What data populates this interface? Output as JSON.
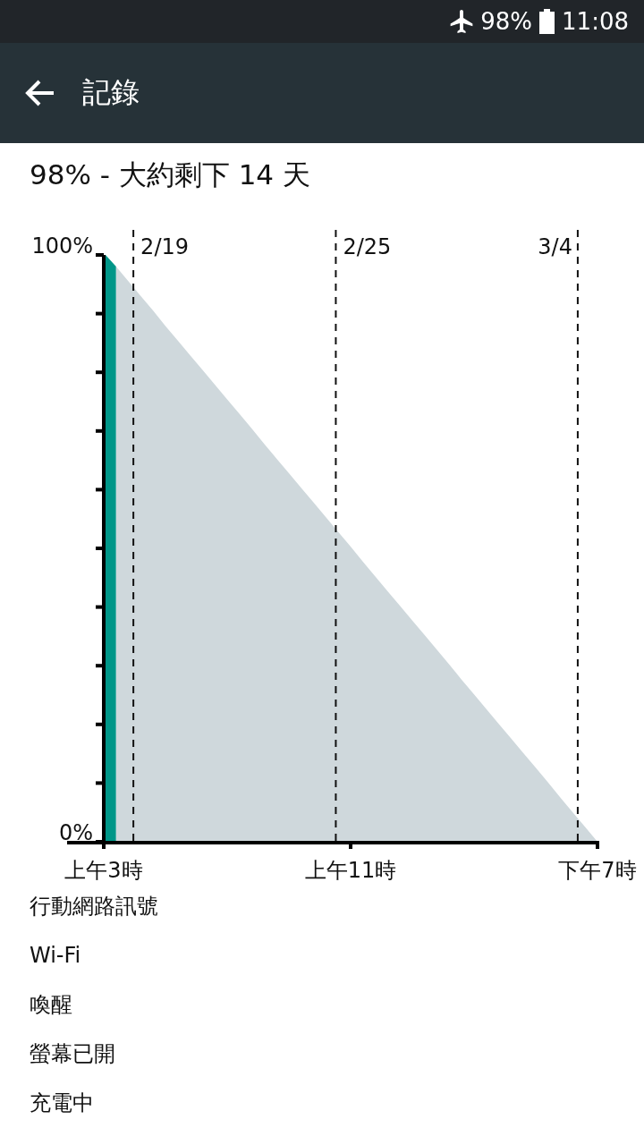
{
  "status_bar": {
    "battery": "98%",
    "time": "11:08"
  },
  "app_bar": {
    "title": "記錄"
  },
  "summary": "98% - 大約剩下 14 天",
  "chart": {
    "chart_data": {
      "type": "area",
      "categories": [
        "上午3時",
        null,
        null,
        null,
        null,
        null,
        null,
        null,
        null,
        null,
        null,
        null,
        null,
        null,
        null,
        null,
        null,
        null,
        null,
        null,
        "上午11時",
        null,
        null,
        null,
        null,
        null,
        null,
        null,
        null,
        null,
        null,
        null,
        null,
        null,
        null,
        null,
        null,
        null,
        null,
        null,
        "下午7時"
      ],
      "series": [
        {
          "color": "#009688",
          "values": [
            100,
            98,
            null,
            null,
            null,
            null,
            null,
            null,
            null,
            null,
            null,
            null,
            null,
            null,
            null,
            null,
            null,
            null,
            null,
            null,
            null,
            null,
            null,
            null,
            null,
            null,
            null,
            null,
            null,
            null,
            null,
            null,
            null,
            null,
            null,
            null,
            null,
            null,
            null,
            null,
            null
          ]
        },
        {
          "color": "#cfd8dc",
          "values": [
            null,
            98,
            95.5,
            93,
            90.5,
            87.9,
            85.4,
            82.9,
            80.4,
            77.9,
            75.4,
            72.9,
            70.4,
            67.8,
            65.3,
            62.8,
            60.3,
            57.8,
            55.3,
            52.8,
            50.3,
            47.7,
            45.2,
            42.7,
            40.2,
            37.7,
            35.2,
            32.7,
            30.2,
            27.6,
            25.1,
            22.6,
            20.1,
            17.6,
            15.1,
            12.6,
            10.1,
            7.5,
            5,
            2.5,
            0
          ]
        }
      ],
      "ylim": [
        0,
        100
      ],
      "yticks": [
        {
          "value": 0,
          "label": "0%"
        },
        {
          "value": 100,
          "label": "100%"
        }
      ],
      "annotations": [
        "2/19",
        "2/25",
        "3/4"
      ]
    }
  },
  "activity_rows": [
    "行動網路訊號",
    "Wi-Fi",
    "喚醒",
    "螢幕已開",
    "充電中"
  ]
}
